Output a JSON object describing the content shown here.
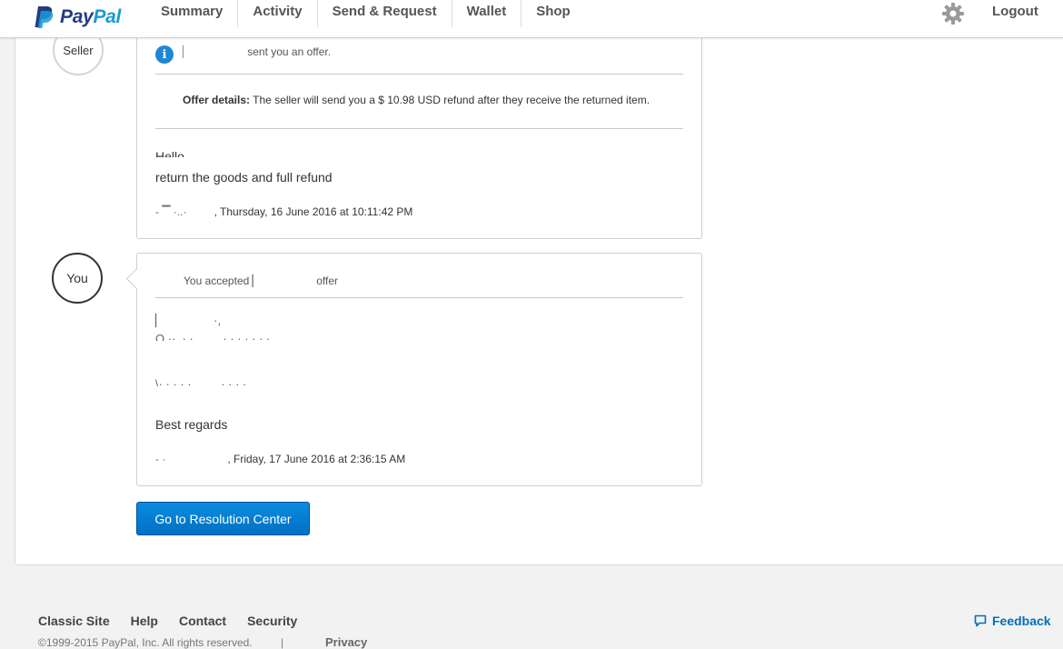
{
  "header": {
    "logo_text_pay": "Pay",
    "logo_text_pal": "Pal",
    "nav": [
      "Summary",
      "Activity",
      "Send & Request",
      "Wallet",
      "Shop"
    ],
    "logout_label": "Logout",
    "icons": {
      "gear": "gear-icon",
      "logo": "paypal-logo"
    }
  },
  "conversation": {
    "seller_label": "Seller",
    "you_label": "You",
    "offer_card": {
      "header_suffix": "sent you an offer.",
      "offer_details_label": "Offer details:",
      "offer_details_text": "The seller will send you a $ 10.98 USD refund after they receive the returned item.",
      "greeting": "Hello",
      "message": "return the goods and full refund",
      "signature_time": ", Thursday, 16 June 2016 at 10:11:42 PM"
    },
    "accepted_card": {
      "header_prefix": "You accepted",
      "header_suffix": "offer",
      "closing": "Best regards",
      "signature_time": ", Friday, 17 June 2016 at 2:36:15 AM"
    },
    "resolution_button": "Go to Resolution Center"
  },
  "footer": {
    "links": [
      "Classic Site",
      "Help",
      "Contact",
      "Security"
    ],
    "copyright": "©1999-2015 PayPal, Inc. All rights reserved.",
    "separator": "|",
    "privacy": "Privacy",
    "feedback": "Feedback"
  },
  "colors": {
    "accent": "#0070ba",
    "button": "#0a8be0",
    "info": "#1e88d6"
  }
}
